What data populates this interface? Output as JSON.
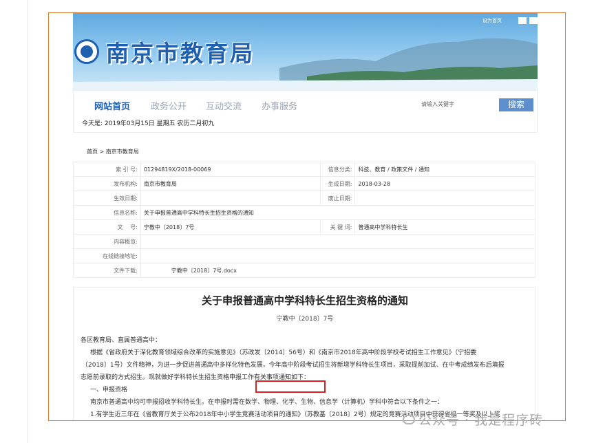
{
  "header": {
    "site_title": "南京市教育局",
    "top_links": "设为首页"
  },
  "nav": {
    "items": [
      "网站首页",
      "政务公开",
      "互动交流",
      "办事服务"
    ],
    "search_placeholder": "请输入关键字",
    "search_button": "搜索",
    "date": "今天是: 2019年03月15日 星期五 农历二月初九"
  },
  "breadcrumb": "首页 > 南京市教育局",
  "meta": {
    "index_label": "索 引 号:",
    "index_value": "01294819X/2018-00069",
    "category_label": "信息分类:",
    "category_value": "科技、教育 / 政策文件 / 通知",
    "issuer_label": "发布机构:",
    "issuer_value": "南京市教育局",
    "created_label": "生成日期:",
    "created_value": "2018-03-28",
    "effective_label": "生效日期:",
    "effective_value": "",
    "expire_label": "废止日期:",
    "expire_value": "",
    "name_label": "信息名称:",
    "name_value": "关于申报普通高中学科特长生招生资格的通知",
    "doc_label": "文　 号:",
    "doc_value": "宁教中〔2018〕7号",
    "keyword_label": "关 键 词:",
    "keyword_value": "普通高中学科特长生",
    "summary_label": "内容概览:",
    "summary_value": "",
    "link_label": "在线链接地址:",
    "link_value": "",
    "download_label": "文件下载:",
    "download_value": "宁教中〔2018〕7号.docx"
  },
  "article": {
    "title": "关于申报普通高中学科特长生招生资格的通知",
    "doc_no": "宁教中〔2018〕7号",
    "lines": [
      "各区教育局、直属普通高中：",
      "根据《省政府关于深化教育领域综合改革的实施意见》（苏政发〔2014〕56号）和《南京市2018年高中阶段学校考试招生工作意见》（宁招委",
      "〔2018〕1号）文件精神，为进一步促进普通高中多样化特色发展，今年高中阶段考试招生将新增学科特长生项目，采取提前加试、在中考成绩发布后填报",
      "志愿前录取的方式招生。现就做好学科特长生招生资格申报工作有关事项通知如下：",
      "一、申报资格",
      "南京市普通高中均可申报招收学科特长生。在申报时需在数学、物理、化学、生物、信息学（计算机）学科中符合以下条件之一：",
      "1.有学生近三年在《省教育厅关于公布2018年中小学生竞赛活动项目的通知》（苏教基〔2018〕2号）规定的竞赛活动项目中获得省级一等奖及以上奖"
    ]
  },
  "watermark": "公众号 · 我是程序砖"
}
